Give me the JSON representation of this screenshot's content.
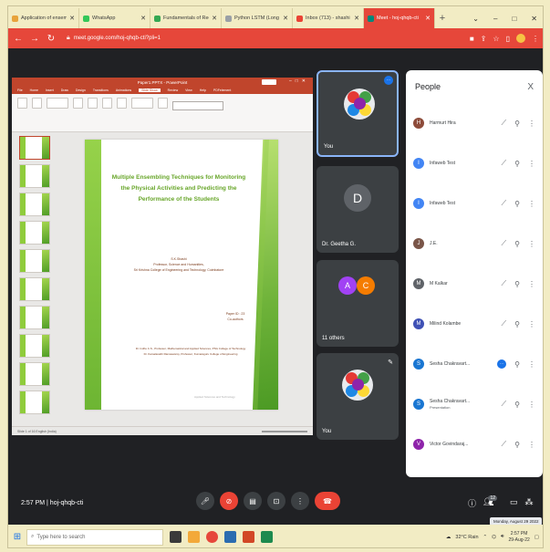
{
  "browser": {
    "tabs": [
      {
        "title": "Application of ensemb",
        "color": "#e8a33b",
        "active": false
      },
      {
        "title": "WhatsApp",
        "color": "#34c759",
        "active": false
      },
      {
        "title": "Fundamentals of Rec",
        "color": "#34a853",
        "active": false
      },
      {
        "title": "Python LSTM (Long S",
        "color": "#9aa0a6",
        "active": false
      },
      {
        "title": "Inbox (713) - shashi",
        "color": "#ea4335",
        "active": false
      },
      {
        "title": "Meet - hoj-qhqb-cti",
        "color": "#00897b",
        "active": true
      }
    ],
    "new_tab": "+",
    "window_controls": [
      "⌄",
      "–",
      "□",
      "✕"
    ],
    "url": "meet.google.com/hoj-qhqb-cti?pli=1"
  },
  "presentation": {
    "app_title": "Paper1.PPTX - PowerPoint",
    "menu": [
      "File",
      "Home",
      "Insert",
      "Draw",
      "Design",
      "Transitions",
      "Animations",
      "Slide Show",
      "Review",
      "View",
      "Help",
      "PDFelement"
    ],
    "active_menu": "Slide Show",
    "slide": {
      "title": "Multiple Ensembling Techniques for Monitoring the Physical Activities and Predicting the Performance of the Students",
      "author_lines": [
        "S.K.Shashi",
        "Professor, Science and Humanities,",
        "Sri Krishna College of Engineering and Technology, Coimbatore"
      ],
      "guide_lines": [
        "Paper ID : 23",
        "Co-authors"
      ],
      "member_lines": [
        "Dr. Indhu C.S., Professor, Mathematical and Applied Sciences, PSG College of Technology",
        "Dr. Kamalavathi Ramaswamy, Professor, Kumaraguru College of Engineering"
      ],
      "corner_text": "Applied Sciences and Technology"
    },
    "status": "Slide 1 of 16   English (India)"
  },
  "tiles": [
    {
      "name": "You",
      "kind": "flower",
      "selected": true
    },
    {
      "name": "Dr. Geetha G.",
      "kind": "letter",
      "letter": "D"
    },
    {
      "name": "11 others",
      "kind": "duo",
      "letters": [
        "A",
        "C"
      ]
    },
    {
      "name": "You",
      "kind": "flower",
      "selected": false
    }
  ],
  "people": {
    "title": "People",
    "close": "X",
    "list": [
      {
        "name": "Harmurt Hira",
        "initial": "H",
        "color": "#8d4b3a",
        "subtitle": ""
      },
      {
        "name": "Infaweb Test",
        "initial": "I",
        "color": "#4285f4",
        "subtitle": ""
      },
      {
        "name": "Infaweb Test",
        "initial": "I",
        "color": "#4285f4",
        "subtitle": ""
      },
      {
        "name": "J.E.",
        "initial": "J",
        "color": "#795548",
        "subtitle": ""
      },
      {
        "name": "M Kalkar",
        "initial": "M",
        "color": "#5f6368",
        "subtitle": ""
      },
      {
        "name": "Milind Kolambe",
        "initial": "M",
        "color": "#3f51b5",
        "subtitle": ""
      },
      {
        "name": "Sesha Chakravart...",
        "initial": "S",
        "color": "#1976d2",
        "subtitle": ""
      },
      {
        "name": "Sesha Chakravart...",
        "initial": "S",
        "color": "#1976d2",
        "subtitle": "Presentation"
      },
      {
        "name": "Victor Govindaraj...",
        "initial": "V",
        "color": "#8e24aa",
        "subtitle": ""
      }
    ]
  },
  "meeting": {
    "time": "2:57 PM",
    "code": "hoj-qhqb-cti",
    "people_count": "12",
    "tooltip": "Monday, August 29 2022"
  },
  "taskbar": {
    "search_placeholder": "Type here to search",
    "weather": "32°C Rain",
    "clock_time": "2:57 PM",
    "clock_date": "29-Aug-22"
  },
  "colors": {
    "meet_bg": "#202124",
    "browser_red": "#e6473a",
    "end_call": "#ea4335",
    "slide_green": "#68a62a"
  }
}
